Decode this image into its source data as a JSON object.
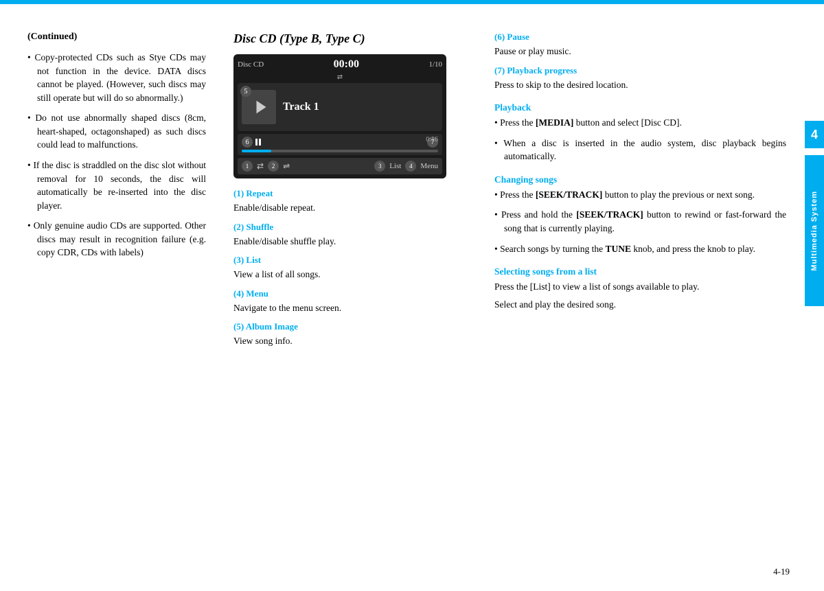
{
  "topBar": {
    "color": "#00AEEF"
  },
  "leftCol": {
    "continued": "(Continued)",
    "bullets": [
      "Copy-protected CDs such as Stye CDs may not function in the device. DATA discs cannot be played. (However, such discs may still operate but will do so abnormally.)",
      "Do not use abnormally shaped discs (8cm, heart-shaped, octagonshaped) as such discs could lead to malfunctions.",
      "If the disc is straddled on the disc slot without removal for 10 seconds, the disc will automatically be re-inserted into the disc player.",
      "Only genuine audio CDs are supported. Other discs may result in recognition failure (e.g. copy CDR, CDs with labels)"
    ]
  },
  "middleCol": {
    "title": "Disc CD (Type B, Type C)",
    "cdPlayer": {
      "label": "Disc CD",
      "time": "00:00",
      "trackNum": "1/10",
      "trackName": "Track 1",
      "progressTime": "0:16",
      "controls": {
        "btn1": "⇄",
        "btn2": "⇌",
        "btn3": "List",
        "btn4": "Menu"
      }
    },
    "sections": [
      {
        "label": "(1) Repeat",
        "body": "Enable/disable repeat."
      },
      {
        "label": "(2) Shuffle",
        "body": "Enable/disable shuffle play."
      },
      {
        "label": "(3) List",
        "body": "View a list of all songs."
      },
      {
        "label": "(4) Menu",
        "body": "Navigate to the menu screen."
      },
      {
        "label": "(5) Album Image",
        "body": "View song info."
      }
    ]
  },
  "rightCol": {
    "sections": [
      {
        "label": "(6) Pause",
        "body": "Pause or play music."
      },
      {
        "label": "(7) Playback progress",
        "body": "Press to skip to the desired location."
      }
    ],
    "playback": {
      "heading": "Playback",
      "bullets": [
        "Press the [MEDIA] button and select [Disc CD].",
        "When a disc is inserted in the audio system, disc playback begins automatically."
      ]
    },
    "changingSongs": {
      "heading": "Changing songs",
      "bullets": [
        "Press the [SEEK/TRACK] button to play the previous or next song.",
        "Press and hold the [SEEK/TRACK] button to rewind or fast-forward the song that is currently playing.",
        "Search songs by turning the TUNE knob, and press the knob to play."
      ]
    },
    "selectingSongs": {
      "heading": "Selecting songs from a list",
      "intro": "Press the [List] to view a list of songs available to play.",
      "outro": "Select and play the desired song."
    }
  },
  "sideTab": {
    "number": "4",
    "label": "Multimedia System"
  },
  "pageNumber": "4-19"
}
